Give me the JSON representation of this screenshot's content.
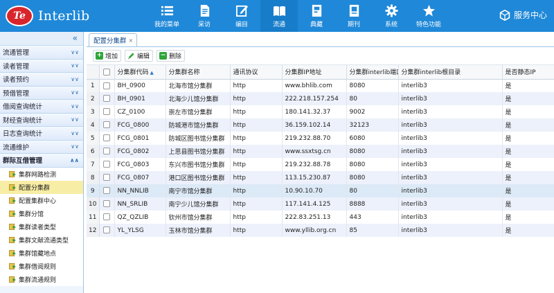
{
  "app": {
    "logo_badge": "Te",
    "logo_text": "Interlib"
  },
  "nav": [
    {
      "label": "我的菜单",
      "icon": "list-icon"
    },
    {
      "label": "采访",
      "icon": "document-icon"
    },
    {
      "label": "编目",
      "icon": "edit-icon"
    },
    {
      "label": "流通",
      "icon": "book-icon"
    },
    {
      "label": "典藏",
      "icon": "archive-icon"
    },
    {
      "label": "期刊",
      "icon": "journal-icon"
    },
    {
      "label": "系统",
      "icon": "gear-icon"
    },
    {
      "label": "特色功能",
      "icon": "star-icon"
    }
  ],
  "service_center": {
    "label": "服务中心",
    "icon": "cube-icon"
  },
  "sidebar": {
    "collapse_glyph": "«",
    "groups": [
      {
        "label": "流通管理"
      },
      {
        "label": "读者管理"
      },
      {
        "label": "读者预约"
      },
      {
        "label": "预借管理"
      },
      {
        "label": "借阅查询统计"
      },
      {
        "label": "财经查询统计"
      },
      {
        "label": "日志查询统计"
      },
      {
        "label": "流通维护"
      }
    ],
    "open_group": {
      "label": "群际互借管理",
      "items": [
        {
          "label": "集群网路检测"
        },
        {
          "label": "配置分集群"
        },
        {
          "label": "配置集群中心"
        },
        {
          "label": "集群分馆"
        },
        {
          "label": "集群读者类型"
        },
        {
          "label": "集群文献流通类型"
        },
        {
          "label": "集群馆藏地点"
        },
        {
          "label": "集群借阅规则"
        },
        {
          "label": "集群流通规则"
        }
      ]
    }
  },
  "tab": {
    "label": "配置分集群",
    "close": "×"
  },
  "toolbar": {
    "add": "增加",
    "edit": "编辑",
    "delete": "删除"
  },
  "grid": {
    "columns": [
      "分集群代码",
      "分集群名称",
      "通讯协议",
      "分集群IP地址",
      "分集群interlib端口",
      "分集群interlib根目录",
      "是否静态IP"
    ],
    "sort_indicator": "▲",
    "rows": [
      {
        "n": "1",
        "code": "BH_0900",
        "name": "北海市馆分集群",
        "proto": "http",
        "ip": "www.bhlib.com",
        "port": "8080",
        "root": "interlib3",
        "static": "是"
      },
      {
        "n": "2",
        "code": "BH_0901",
        "name": "北海少儿馆分集群",
        "proto": "http",
        "ip": "222.218.157.254",
        "port": "80",
        "root": "interlib3",
        "static": "是"
      },
      {
        "n": "3",
        "code": "CZ_0100",
        "name": "崇左市馆分集群",
        "proto": "http",
        "ip": "180.141.32.37",
        "port": "9002",
        "root": "interlib3",
        "static": "是"
      },
      {
        "n": "4",
        "code": "FCG_0800",
        "name": "防城港市馆分集群",
        "proto": "http",
        "ip": "36.159.102.14",
        "port": "32123",
        "root": "interlib3",
        "static": "是"
      },
      {
        "n": "5",
        "code": "FCG_0801",
        "name": "防城区图书馆分集群",
        "proto": "http",
        "ip": "219.232.88.70",
        "port": "6080",
        "root": "interlib3",
        "static": "是"
      },
      {
        "n": "6",
        "code": "FCG_0802",
        "name": "上思县图书馆分集群",
        "proto": "http",
        "ip": "www.ssxtsg.cn",
        "port": "8080",
        "root": "interlib3",
        "static": "是"
      },
      {
        "n": "7",
        "code": "FCG_0803",
        "name": "东兴市图书馆分集群",
        "proto": "http",
        "ip": "219.232.88.78",
        "port": "8080",
        "root": "interlib3",
        "static": "是"
      },
      {
        "n": "8",
        "code": "FCG_0807",
        "name": "港口区图书馆分集群",
        "proto": "http",
        "ip": "113.15.230.87",
        "port": "8080",
        "root": "interlib3",
        "static": "是"
      },
      {
        "n": "9",
        "code": "NN_NNLIB",
        "name": "南宁市馆分集群",
        "proto": "http",
        "ip": "10.90.10.70",
        "port": "80",
        "root": "interlib3",
        "static": "是"
      },
      {
        "n": "10",
        "code": "NN_SRLIB",
        "name": "南宁少儿馆分集群",
        "proto": "http",
        "ip": "117.141.4.125",
        "port": "8888",
        "root": "interlib3",
        "static": "是"
      },
      {
        "n": "11",
        "code": "QZ_QZLIB",
        "name": "钦州市馆分集群",
        "proto": "http",
        "ip": "222.83.251.13",
        "port": "443",
        "root": "interlib3",
        "static": "是"
      },
      {
        "n": "12",
        "code": "YL_YLSG",
        "name": "玉林市馆分集群",
        "proto": "http",
        "ip": "www.yllib.org.cn",
        "port": "85",
        "root": "interlib3",
        "static": "是"
      }
    ]
  },
  "colors": {
    "topbar": "#1f88d8",
    "logo_red": "#d8252b",
    "selected_menu": "#f7eda4",
    "alt_row": "#edf1fb"
  }
}
